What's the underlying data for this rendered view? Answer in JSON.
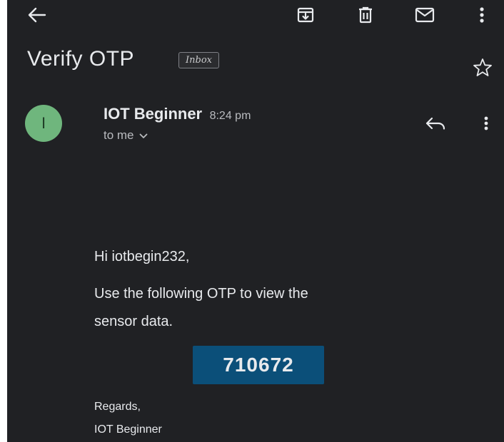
{
  "toolbar": {
    "back_icon": "arrow-left-icon",
    "archive_icon": "archive-icon",
    "delete_icon": "trash-icon",
    "mark_unread_icon": "envelope-icon",
    "more_icon": "more-vert-icon"
  },
  "email": {
    "subject": "Verify OTP",
    "label": "Inbox",
    "star_icon": "star-outline-icon",
    "sender": {
      "initial": "I",
      "name": "IOT Beginner",
      "time": "8:24 pm",
      "to": "to me"
    },
    "body": {
      "greeting": "Hi iotbegin232,",
      "line1": "Use the following OTP to view the",
      "line2": "sensor data.",
      "otp": "710672",
      "regards": "Regards,",
      "signature": "IOT Beginner"
    }
  },
  "colors": {
    "background": "#202124",
    "avatar": "#6fb67d",
    "otp_box": "#0b4f79",
    "text": "#e8eaed"
  }
}
